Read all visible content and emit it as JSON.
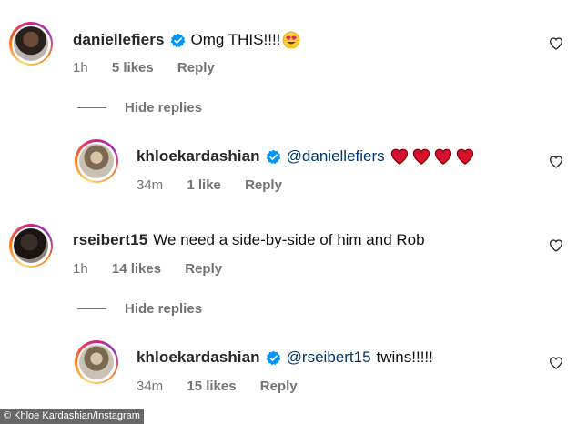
{
  "comments": [
    {
      "username": "daniellefiers",
      "text": "Omg THIS!!!!",
      "time": "1h",
      "likes": "5 likes",
      "reply": "Reply"
    },
    {
      "username": "khloekardashian",
      "mention": "@daniellefiers",
      "time": "34m",
      "likes": "1 like",
      "reply": "Reply"
    },
    {
      "username": "rseibert15",
      "text": "We need a side-by-side of him and Rob",
      "time": "1h",
      "likes": "14 likes",
      "reply": "Reply"
    },
    {
      "username": "khloekardashian",
      "mention": "@rseibert15",
      "text": "twins!!!!!",
      "time": "34m",
      "likes": "15 likes",
      "reply": "Reply"
    }
  ],
  "hide_replies": "Hide replies",
  "credit": "© Khloe Kardashian/Instagram",
  "colors": {
    "verified": "#0095f6",
    "mention": "#00376b",
    "meta": "#737373",
    "heart_emoji": "#e0245e"
  },
  "icons": [
    "verified-badge-icon",
    "heart-eyes-emoji",
    "red-heart-emoji",
    "like-heart-icon"
  ]
}
